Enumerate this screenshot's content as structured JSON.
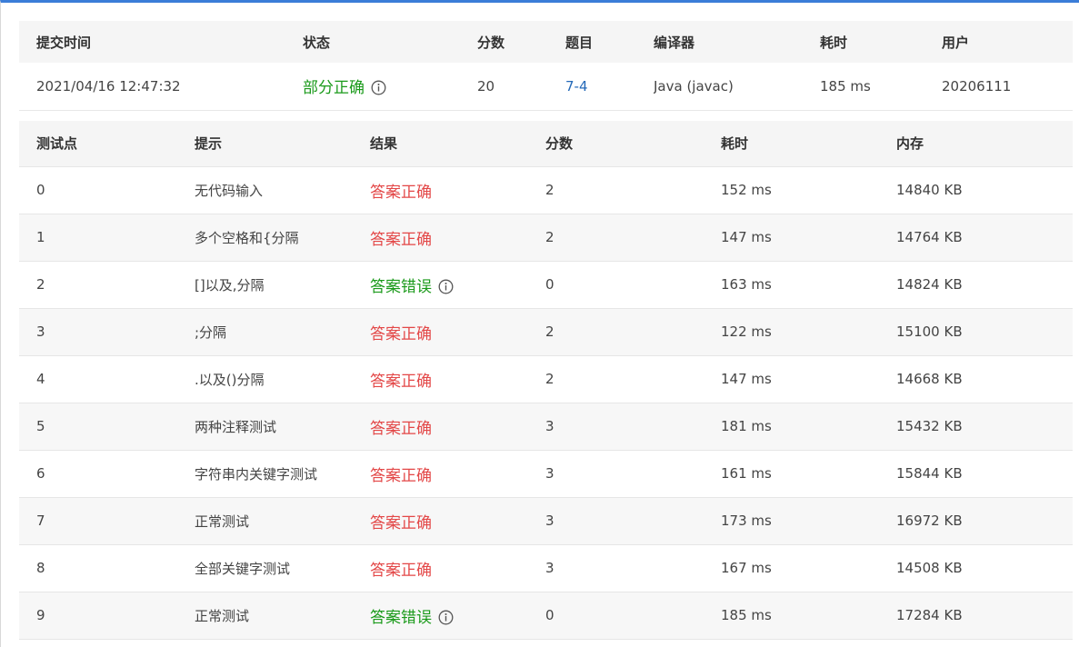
{
  "submission": {
    "headers": [
      "提交时间",
      "状态",
      "分数",
      "题目",
      "编译器",
      "耗时",
      "用户"
    ],
    "row": {
      "time": "2021/04/16 12:47:32",
      "status": "部分正确",
      "score": "20",
      "problem": "7-4",
      "compiler": "Java (javac)",
      "elapsed": "185 ms",
      "user": "20206111"
    }
  },
  "cases": {
    "headers": [
      "测试点",
      "提示",
      "结果",
      "分数",
      "耗时",
      "内存"
    ],
    "rows": [
      {
        "id": "0",
        "hint": "无代码输入",
        "result": "答案正确",
        "ok": true,
        "score": "2",
        "time": "152 ms",
        "memory": "14840 KB"
      },
      {
        "id": "1",
        "hint": "多个空格和{分隔",
        "result": "答案正确",
        "ok": true,
        "score": "2",
        "time": "147 ms",
        "memory": "14764 KB"
      },
      {
        "id": "2",
        "hint": "[]以及,分隔",
        "result": "答案错误",
        "ok": false,
        "score": "0",
        "time": "163 ms",
        "memory": "14824 KB"
      },
      {
        "id": "3",
        "hint": ";分隔",
        "result": "答案正确",
        "ok": true,
        "score": "2",
        "time": "122 ms",
        "memory": "15100 KB"
      },
      {
        "id": "4",
        "hint": ".以及()分隔",
        "result": "答案正确",
        "ok": true,
        "score": "2",
        "time": "147 ms",
        "memory": "14668 KB"
      },
      {
        "id": "5",
        "hint": "两种注释测试",
        "result": "答案正确",
        "ok": true,
        "score": "3",
        "time": "181 ms",
        "memory": "15432 KB"
      },
      {
        "id": "6",
        "hint": "字符串内关键字测试",
        "result": "答案正确",
        "ok": true,
        "score": "3",
        "time": "161 ms",
        "memory": "15844 KB"
      },
      {
        "id": "7",
        "hint": "正常测试",
        "result": "答案正确",
        "ok": true,
        "score": "3",
        "time": "173 ms",
        "memory": "16972 KB"
      },
      {
        "id": "8",
        "hint": "全部关键字测试",
        "result": "答案正确",
        "ok": true,
        "score": "3",
        "time": "167 ms",
        "memory": "14508 KB"
      },
      {
        "id": "9",
        "hint": "正常测试",
        "result": "答案错误",
        "ok": false,
        "score": "0",
        "time": "185 ms",
        "memory": "17284 KB"
      }
    ]
  },
  "colors": {
    "accent": "#3b7dd8",
    "correct_result": "#e34747",
    "wrong_result": "#1a9a1a",
    "link": "#2469b8"
  },
  "icons": {
    "info": "info-circle-icon"
  }
}
